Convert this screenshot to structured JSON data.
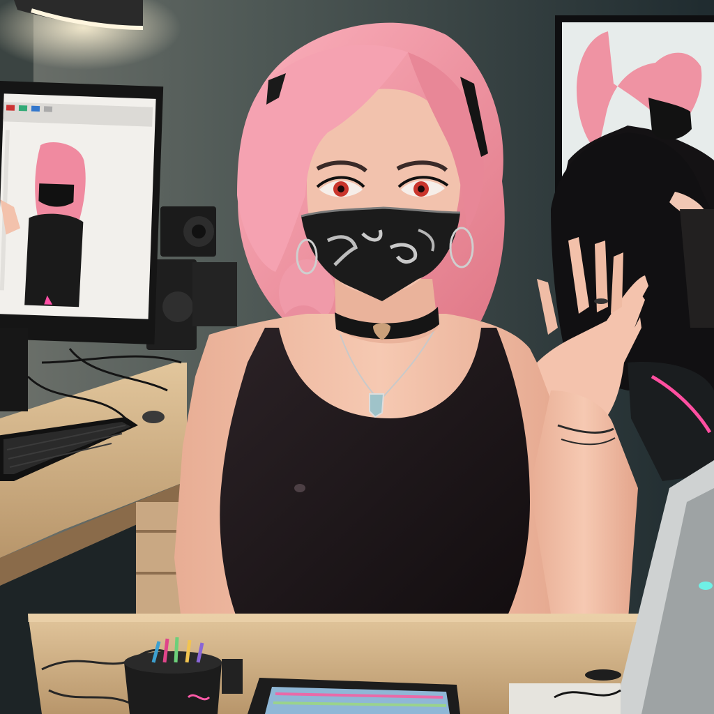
{
  "scene": {
    "description_visible_text": "",
    "palette": {
      "wall_dark": "#243134",
      "wall_light": "#5f6862",
      "desk": "#d8b98e",
      "desk_shadow": "#a98862",
      "hair": "#f497a6",
      "hair_shadow": "#d8707f",
      "skin": "#f3c0a8",
      "skin_shadow": "#d99882",
      "top": "#1c1618",
      "mask": "#1a1a1a",
      "accent_pink": "#ff5aa8",
      "screen_glow": "#f1efe9"
    },
    "icons": [
      "desk-lamp-icon",
      "monitor-icon",
      "keyboard-icon",
      "mouse-icon",
      "speaker-icon",
      "pen-cup-icon",
      "tablet-icon",
      "chair-icon"
    ]
  }
}
